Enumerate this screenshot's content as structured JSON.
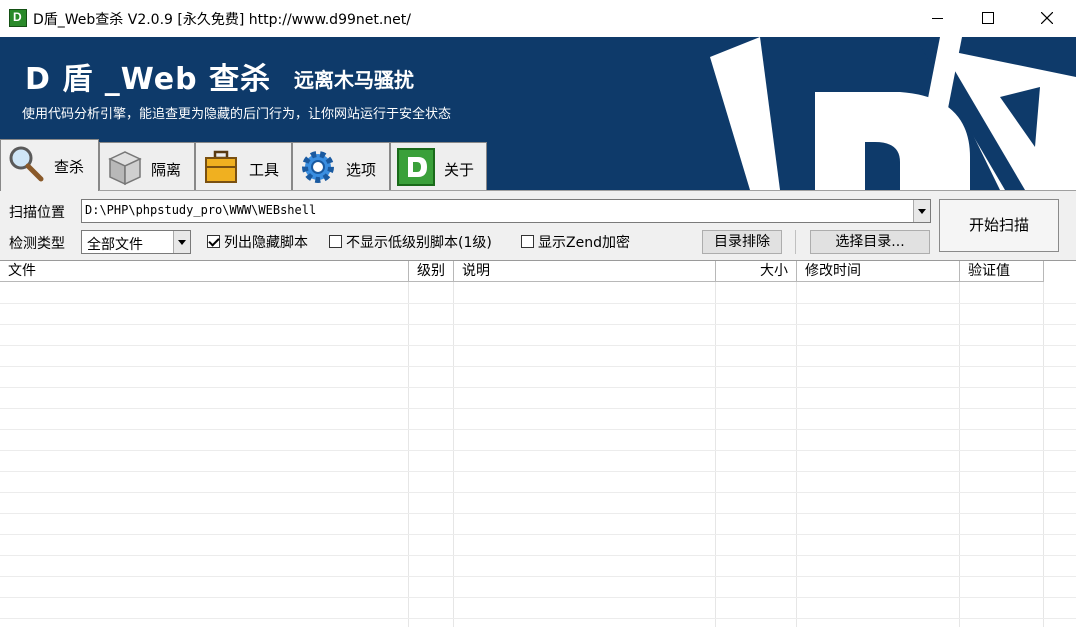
{
  "window": {
    "title": "D盾_Web查杀 V2.0.9 [永久免费] http://www.d99net.net/"
  },
  "banner": {
    "title": "D 盾 _Web 查杀",
    "subtitle": "远离木马骚扰",
    "slogan": "使用代码分析引擎，能追查更为隐藏的后门行为，让你网站运行于安全状态"
  },
  "tabs": [
    {
      "label": "查杀",
      "icon": "magnifier-icon",
      "active": true
    },
    {
      "label": "隔离",
      "icon": "box-icon",
      "active": false
    },
    {
      "label": "工具",
      "icon": "toolbox-icon",
      "active": false
    },
    {
      "label": "选项",
      "icon": "gear-icon",
      "active": false
    },
    {
      "label": "关于",
      "icon": "d-logo-icon",
      "active": false
    }
  ],
  "scan": {
    "location_label": "扫描位置",
    "location_value": "D:\\PHP\\phpstudy_pro\\WWW\\WEBshell",
    "type_label": "检测类型",
    "type_value": "全部文件",
    "opt_hidden_label": "列出隐藏脚本",
    "opt_hidden_checked": true,
    "opt_lowlevel_label": "不显示低级别脚本(1级)",
    "opt_lowlevel_checked": false,
    "opt_zend_label": "显示Zend加密",
    "opt_zend_checked": false,
    "exclude_dir_label": "目录排除",
    "select_dir_label": "选择目录...",
    "start_label": "开始扫描"
  },
  "table": {
    "columns": [
      "文件",
      "级别",
      "说明",
      "大小",
      "修改时间",
      "验证值"
    ],
    "rows": []
  },
  "colors": {
    "banner_bg": "#0e3a6a",
    "panel_bg": "#f0f0f0"
  }
}
